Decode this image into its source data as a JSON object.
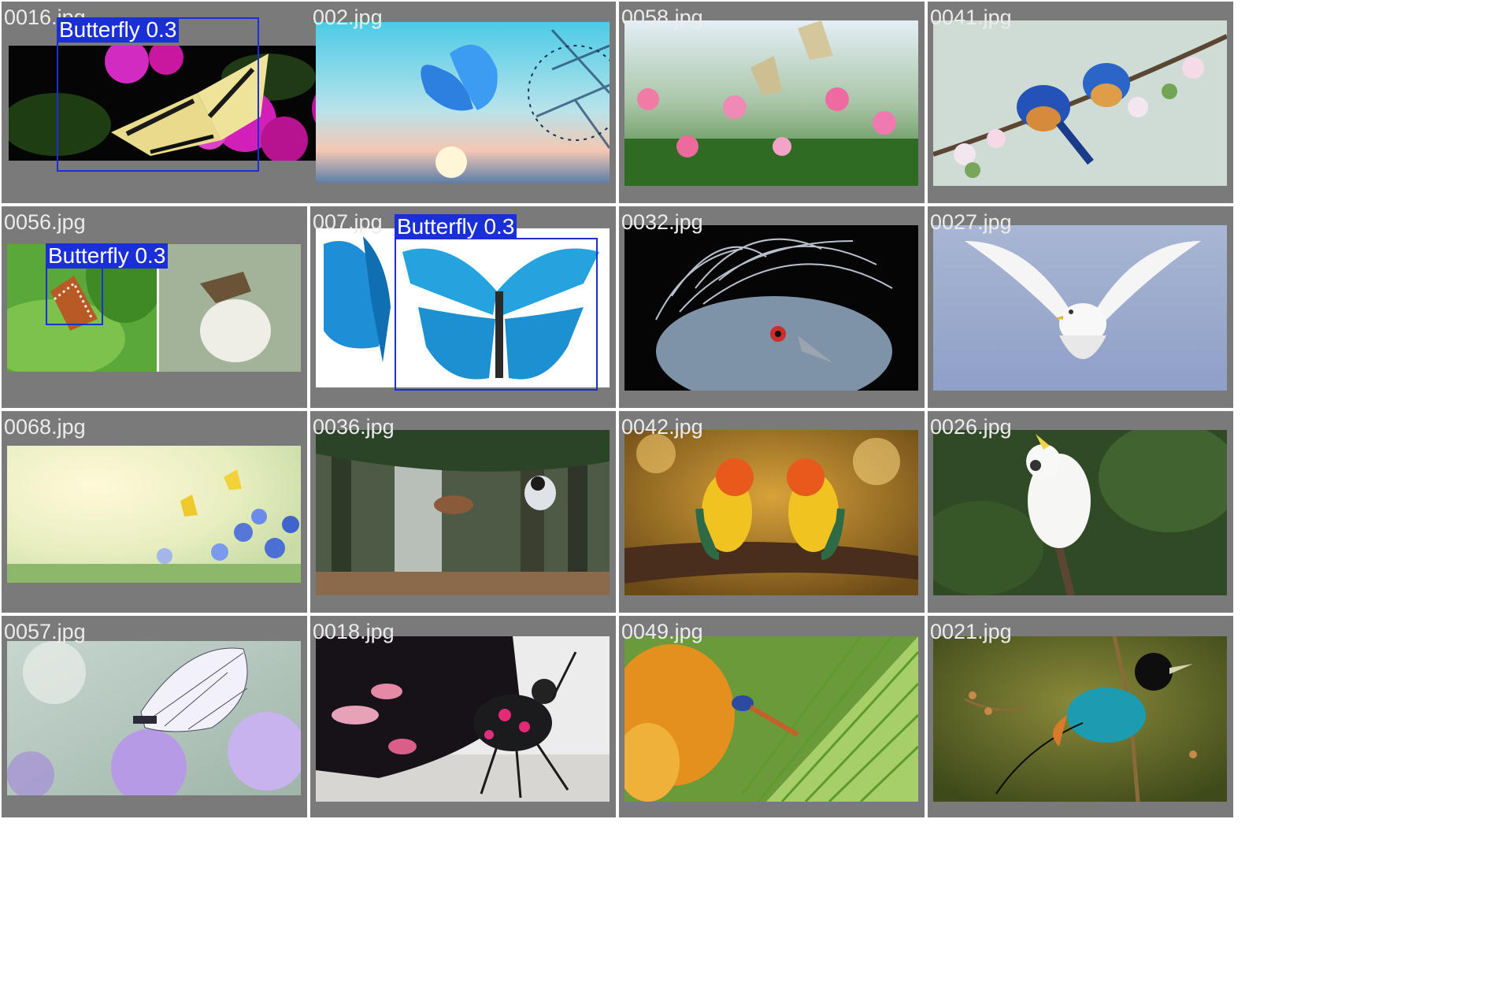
{
  "tiles": [
    {
      "filename": "0016.jpg",
      "subject": "swallowtail butterfly on magenta flowers",
      "detection": {
        "label": "Butterfly 0.3",
        "class": "Butterfly",
        "confidence": 0.3
      }
    },
    {
      "filename": "002.jpg",
      "subject": "blue morpho butterfly at sunset with dandelion"
    },
    {
      "filename": "0058.jpg",
      "subject": "two swallowtail butterflies over pink flowers"
    },
    {
      "filename": "0041.jpg",
      "subject": "two bluebirds on blossoming branch"
    },
    {
      "filename": "0056.jpg",
      "subject": "checkerspot butterfly on leaf and skipper on clover",
      "detection": {
        "label": "Butterfly 0.3",
        "class": "Butterfly",
        "confidence": 0.3
      }
    },
    {
      "filename": "007.jpg",
      "subject": "blue morpho butterflies on white",
      "detection": {
        "label": "Butterfly 0.3",
        "class": "Butterfly",
        "confidence": 0.3
      }
    },
    {
      "filename": "0032.jpg",
      "subject": "victoria crowned pigeon"
    },
    {
      "filename": "0027.jpg",
      "subject": "white seagull in flight"
    },
    {
      "filename": "0068.jpg",
      "subject": "yellow butterflies over blue flowers"
    },
    {
      "filename": "0036.jpg",
      "subject": "two small birds flying in forest"
    },
    {
      "filename": "0042.jpg",
      "subject": "two lovebirds on branch"
    },
    {
      "filename": "0026.jpg",
      "subject": "white cockatoo"
    },
    {
      "filename": "0057.jpg",
      "subject": "white butterfly on purple flower"
    },
    {
      "filename": "0018.jpg",
      "subject": "black and pink butterfly close-up"
    },
    {
      "filename": "0049.jpg",
      "subject": "paradise flycatcher on palm leaf"
    },
    {
      "filename": "0021.jpg",
      "subject": "bird of paradise on branch"
    }
  ],
  "colors": {
    "tile_bg": "#7a7a7a",
    "label_text": "#ececec",
    "detection_box": "#1a2fd6"
  }
}
